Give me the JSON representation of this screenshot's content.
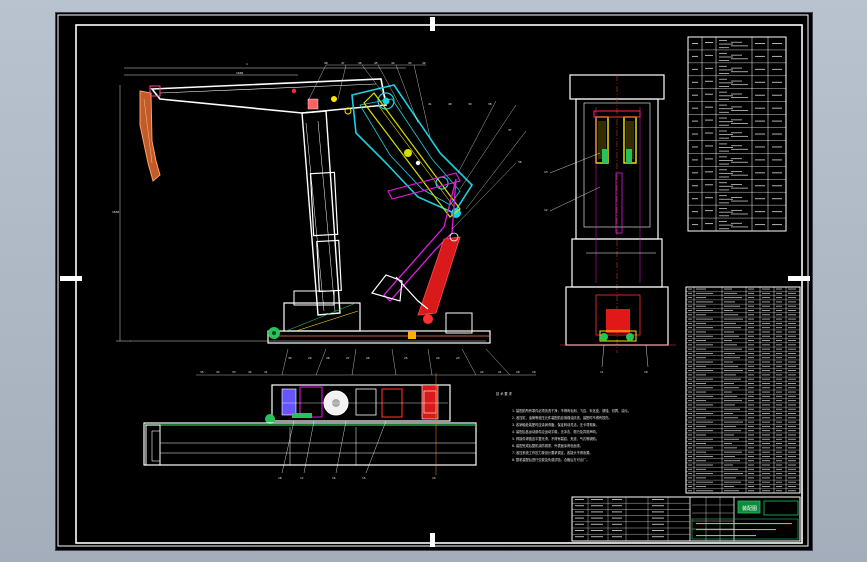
{
  "drawing": {
    "background": "#000000",
    "frame_color": "#ffffff",
    "notes_title": "技 术 要 求",
    "notes_lines": [
      "1. 装配前所有零件必须清洗干净，不得有毛刺、飞边、氧化皮、锈蚀、切屑、油污。",
      "2. 液压缸、油管等液压元件装配前应用煤油清洗，装配时不得有损伤。",
      "3. 各销轴处装配时应涂润滑脂，保证转动灵活，无卡滞现象。",
      "4. 装配后各运动部件应运动平稳，无冲击、爬行及异常声响。",
      "5. 焊接件焊缝应平整光滑，不得有裂纹、夹渣、气孔等缺陷。",
      "6. 装配完成后整机涂防锈漆，外表面涂黄色面漆。",
      "7. 液压系统工作压力按设计要求调定，各接头不得渗漏。",
      "8. 整机装配后进行空载及负载试验，合格后方可出厂。"
    ],
    "title_block_label": "装配图",
    "colors": {
      "cyan": "#19d3e0",
      "magenta": "#e21be0",
      "red": "#ff1a1a",
      "yellow": "#f4e600",
      "green": "#22c35a",
      "blue": "#3355ff",
      "orange": "#ff8a1a"
    }
  }
}
